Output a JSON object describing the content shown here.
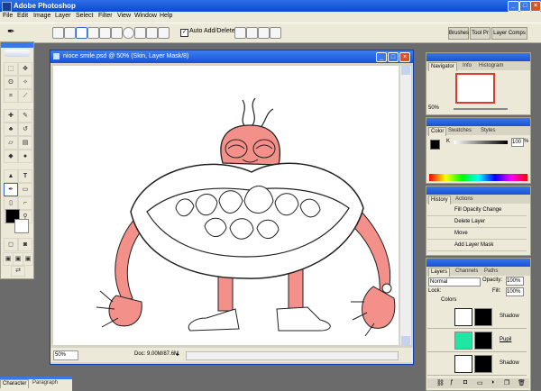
{
  "app": {
    "title": "Adobe Photoshop"
  },
  "menu": [
    "File",
    "Edit",
    "Image",
    "Layer",
    "Select",
    "Filter",
    "View",
    "Window",
    "Help"
  ],
  "options": {
    "auto_add_delete": "Auto Add/Delete"
  },
  "palette_well": {
    "tabs": [
      "Brushes",
      "Tool Pr",
      "Layer Comps"
    ]
  },
  "document": {
    "title": "nioce smile.psd @ 50% (Skin, Layer Mask/8)",
    "zoom": "50%",
    "doc_info": "Doc: 9.00M/87.6M"
  },
  "navigator": {
    "tabs": [
      "Navigator",
      "Info",
      "Histogram"
    ],
    "zoom": "50%"
  },
  "color": {
    "tabs": [
      "Color",
      "Swatches",
      "Styles"
    ],
    "channel": "K",
    "value": "100",
    "unit": "%"
  },
  "history": {
    "tabs": [
      "History",
      "Actions"
    ],
    "items": [
      "Fill Opacity Change",
      "Delete Layer",
      "Move",
      "Add Layer Mask"
    ]
  },
  "layers": {
    "tabs": [
      "Layers",
      "Channels",
      "Paths"
    ],
    "blend_mode": "Normal",
    "opacity_label": "Opacity:",
    "opacity_value": "100%",
    "lock_label": "Lock:",
    "fill_label": "Fill:",
    "fill_value": "100%",
    "group_name": "Colors",
    "rows": [
      {
        "name": "Shadow"
      },
      {
        "name": "Pupil"
      },
      {
        "name": "Shadow"
      }
    ]
  },
  "character": {
    "tabs": [
      "Character",
      "Paragraph"
    ]
  },
  "colors": {
    "titlebar": "#0a4bd0",
    "skin": "#f4908a",
    "pupil_swatch": "#1fe6a2"
  }
}
